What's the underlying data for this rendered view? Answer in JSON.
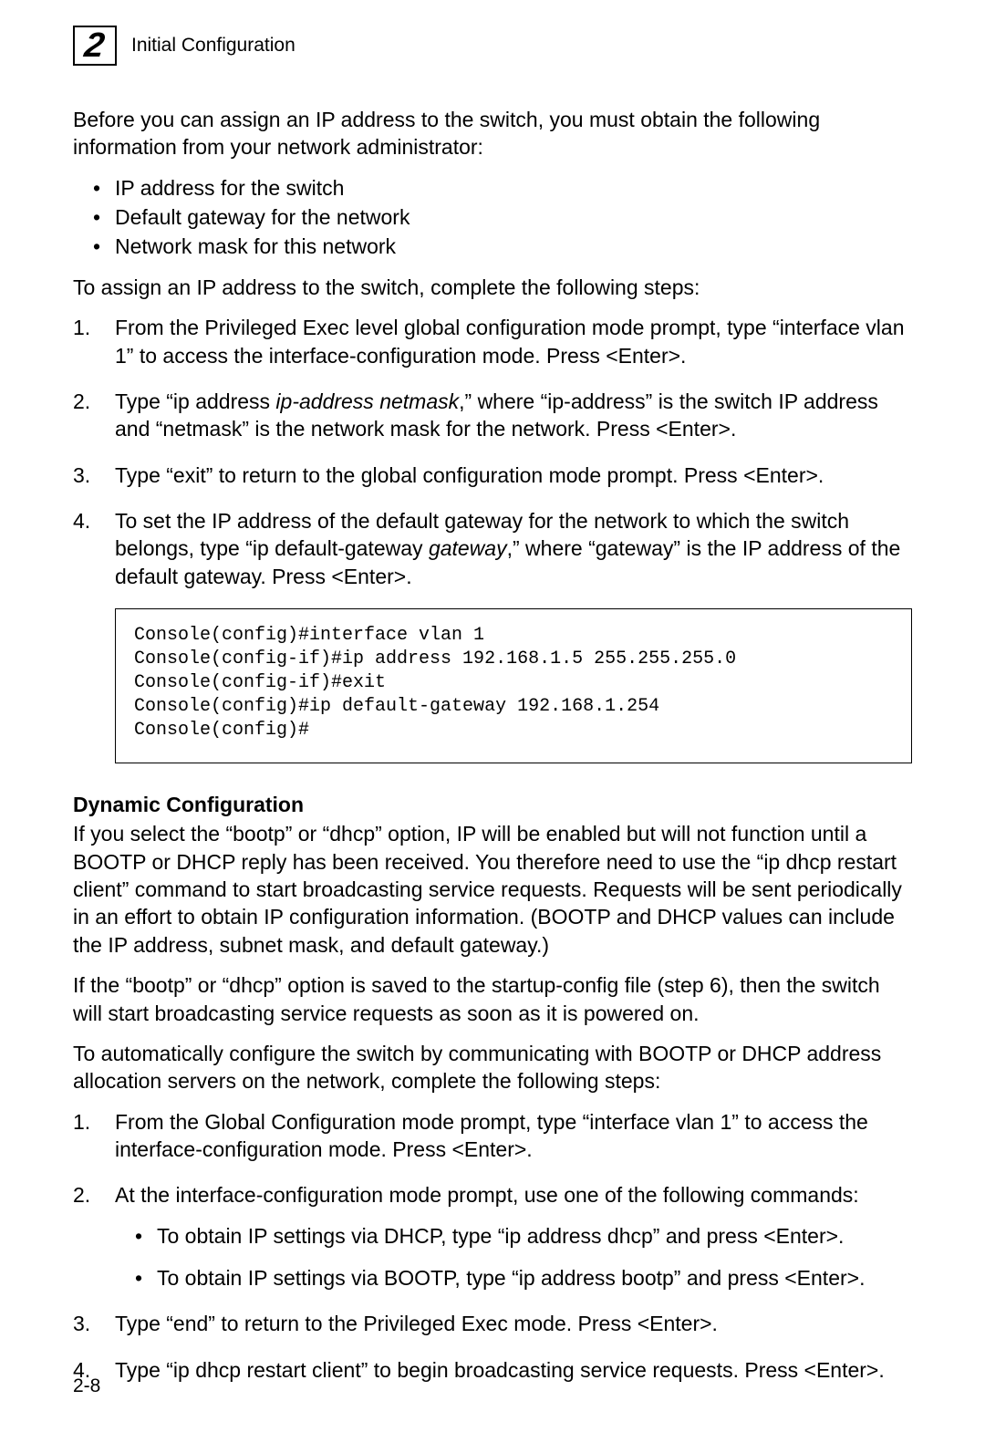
{
  "header": {
    "chapter_number": "2",
    "title": "Initial Configuration"
  },
  "intro_para": "Before you can assign an IP address to the switch, you must obtain the following information from your network administrator:",
  "info_bullets": [
    "IP address for the switch",
    "Default gateway for the network",
    "Network mask for this network"
  ],
  "assign_para": "To assign an IP address to the switch, complete the following steps:",
  "steps1": [
    "From the Privileged Exec level global configuration mode prompt, type “interface vlan 1” to access the interface-configuration mode. Press <Enter>.",
    "Type “ip address ip-address netmask,” where “ip-address” is the switch IP address and “netmask” is the network mask for the network. Press <Enter>.",
    "Type “exit” to return to the global configuration mode prompt. Press <Enter>.",
    "To set the IP address of the default gateway for the network to which the switch belongs, type “ip default-gateway gateway,” where “gateway” is the IP address of the default gateway. Press <Enter>."
  ],
  "code_block": "Console(config)#interface vlan 1\nConsole(config-if)#ip address 192.168.1.5 255.255.255.0\nConsole(config-if)#exit\nConsole(config)#ip default-gateway 192.168.1.254\nConsole(config)#",
  "dynamic": {
    "heading": "Dynamic Configuration",
    "para1": "If you select the “bootp” or “dhcp” option, IP will be enabled but will not function until a BOOTP or DHCP reply has been received. You therefore need to use the “ip dhcp restart client” command to start broadcasting service requests. Requests will be sent periodically in an effort to obtain IP configuration information. (BOOTP and DHCP values can include the IP address, subnet mask, and default gateway.)",
    "para2": "If the “bootp” or “dhcp” option is saved to the startup-config file (step 6), then the switch will start broadcasting service requests as soon as it is powered on.",
    "para3": "To automatically configure the switch by communicating with BOOTP or DHCP address allocation servers on the network, complete the following steps:",
    "steps": [
      {
        "text": "From the Global Configuration mode prompt, type “interface vlan 1” to access the interface-configuration mode. Press <Enter>.",
        "sub": []
      },
      {
        "text": "At the interface-configuration mode prompt, use one of the following commands:",
        "sub": [
          "To obtain IP settings via DHCP, type “ip address dhcp” and press <Enter>.",
          "To obtain IP settings via BOOTP, type “ip address bootp” and press <Enter>."
        ]
      },
      {
        "text": "Type “end” to return to the Privileged Exec mode. Press <Enter>.",
        "sub": []
      },
      {
        "text": "Type “ip dhcp restart client” to begin broadcasting service requests. Press <Enter>.",
        "sub": []
      }
    ]
  },
  "page_number": "2-8"
}
